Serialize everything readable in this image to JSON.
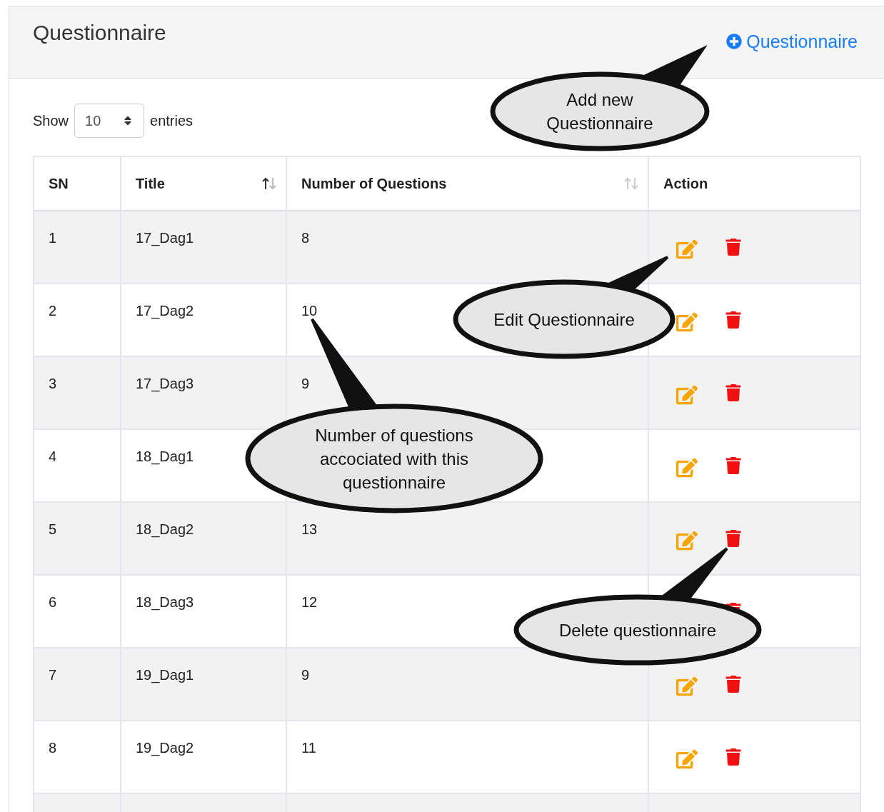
{
  "panel": {
    "title": "Questionnaire",
    "add_link": "Questionnaire"
  },
  "length_menu": {
    "label_before": "Show",
    "value": "10",
    "label_after": "entries"
  },
  "table": {
    "columns": [
      {
        "label": "SN"
      },
      {
        "label": "Title",
        "sorted": true
      },
      {
        "label": "Number of Questions",
        "sorted": false
      },
      {
        "label": "Action"
      }
    ],
    "rows": [
      {
        "sn": "1",
        "title": "17_Dag1",
        "questions": "8"
      },
      {
        "sn": "2",
        "title": "17_Dag2",
        "questions": "10"
      },
      {
        "sn": "3",
        "title": "17_Dag3",
        "questions": "9"
      },
      {
        "sn": "4",
        "title": "18_Dag1"
      },
      {
        "sn": "5",
        "title": "18_Dag2",
        "questions": "13"
      },
      {
        "sn": "6",
        "title": "18_Dag3",
        "questions": "12"
      },
      {
        "sn": "7",
        "title": "19_Dag1",
        "questions": "9"
      },
      {
        "sn": "8",
        "title": "19_Dag2",
        "questions": "11"
      }
    ]
  },
  "callouts": [
    {
      "text": "Add new Questionnaire"
    },
    {
      "text": "Edit Questionnaire"
    },
    {
      "text": "Number of questions accociated with this questionnaire"
    },
    {
      "text": "Delete questionnaire"
    }
  ]
}
